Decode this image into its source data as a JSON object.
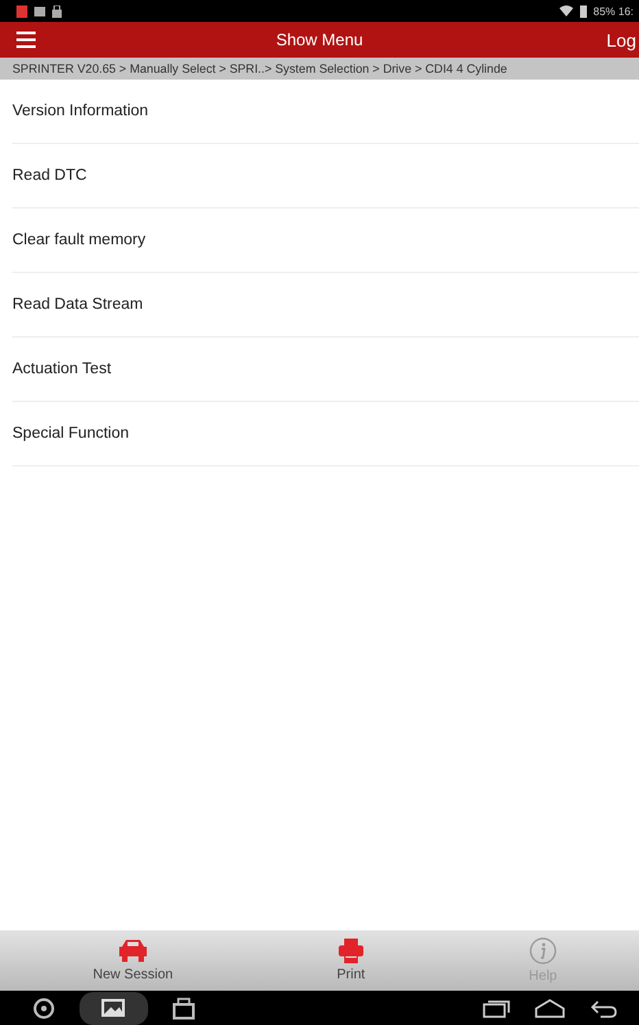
{
  "status_bar": {
    "battery": "85% 16:"
  },
  "header": {
    "title": "Show Menu",
    "right": "Log"
  },
  "breadcrumb": "SPRINTER V20.65 > Manually Select > SPRI..> System Selection > Drive > CDI4 4 Cylinde",
  "menu": [
    {
      "label": "Version Information"
    },
    {
      "label": "Read DTC"
    },
    {
      "label": "Clear fault memory"
    },
    {
      "label": "Read Data Stream"
    },
    {
      "label": "Actuation Test"
    },
    {
      "label": "Special Function"
    }
  ],
  "toolbar": [
    {
      "kind": "car",
      "label": "New Session",
      "disabled": false
    },
    {
      "kind": "print",
      "label": "Print",
      "disabled": false
    },
    {
      "kind": "help",
      "label": "Help",
      "disabled": true
    }
  ]
}
